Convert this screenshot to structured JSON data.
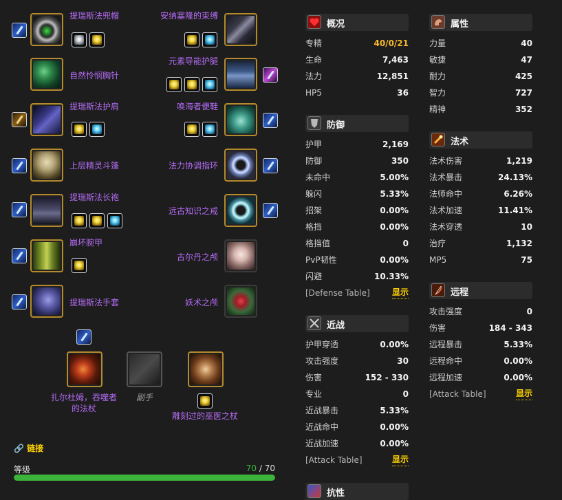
{
  "items": {
    "head": {
      "name": "提瑞斯法兜帽"
    },
    "neck": {
      "name": "自然怜悯胸针"
    },
    "shoulder": {
      "name": "提瑞斯法护肩"
    },
    "back": {
      "name": "上层精灵斗篷"
    },
    "chest": {
      "name": "提瑞斯法长袍"
    },
    "wrist": {
      "name": "崩坏腕甲"
    },
    "hands": {
      "name": "提瑞斯法手套"
    },
    "waist": {
      "name": "安纳塞隆的束缚"
    },
    "legs": {
      "name": "元素导能护腿"
    },
    "feet": {
      "name": "唤海者便鞋"
    },
    "ring1": {
      "name": "法力协调指环"
    },
    "ring2": {
      "name": "远古知识之戒"
    },
    "trinket1": {
      "name": "古尔丹之颅"
    },
    "trinket2": {
      "name": "妖术之颅"
    },
    "mainhand": {
      "name": "扎尔杜姆，吞噬者的法杖"
    },
    "offhand": {
      "name": "副手"
    },
    "ranged": {
      "name": "雕刻过的巫医之杖"
    }
  },
  "overview": {
    "title": "概况",
    "rows": [
      {
        "label": "专精",
        "value": "40/0/21"
      },
      {
        "label": "生命",
        "value": "7,463"
      },
      {
        "label": "法力",
        "value": "12,851"
      },
      {
        "label": "HP5",
        "value": "36"
      }
    ]
  },
  "defense": {
    "title": "防御",
    "rows": [
      {
        "label": "护甲",
        "value": "2,169"
      },
      {
        "label": "防御",
        "value": "350"
      },
      {
        "label": "未命中",
        "value": "5.00%"
      },
      {
        "label": "躲闪",
        "value": "5.33%"
      },
      {
        "label": "招架",
        "value": "0.00%"
      },
      {
        "label": "格挡",
        "value": "0.00%"
      },
      {
        "label": "格挡值",
        "value": "0"
      },
      {
        "label": "PvP韧性",
        "value": "0.00%"
      },
      {
        "label": "闪避",
        "value": "10.33%"
      }
    ],
    "table_label": "[Defense Table]",
    "show": "显示"
  },
  "melee": {
    "title": "近战",
    "rows": [
      {
        "label": "护甲穿透",
        "value": "0.00%"
      },
      {
        "label": "攻击强度",
        "value": "30"
      },
      {
        "label": "伤害",
        "value": "152 - 330"
      },
      {
        "label": "专业",
        "value": "0"
      },
      {
        "label": "近战暴击",
        "value": "5.33%"
      },
      {
        "label": "近战命中",
        "value": "0.00%"
      },
      {
        "label": "近战加速",
        "value": "0.00%"
      }
    ],
    "table_label": "[Attack Table]",
    "show": "显示"
  },
  "resist": {
    "title": "抗性"
  },
  "attributes": {
    "title": "属性",
    "rows": [
      {
        "label": "力量",
        "value": "40"
      },
      {
        "label": "敏捷",
        "value": "47"
      },
      {
        "label": "耐力",
        "value": "425"
      },
      {
        "label": "智力",
        "value": "727"
      },
      {
        "label": "精神",
        "value": "352"
      }
    ]
  },
  "spell": {
    "title": "法术",
    "rows": [
      {
        "label": "法术伤害",
        "value": "1,219"
      },
      {
        "label": "法术暴击",
        "value": "24.13%"
      },
      {
        "label": "法师命中",
        "value": "6.26%"
      },
      {
        "label": "法术加速",
        "value": "11.41%"
      },
      {
        "label": "法术穿透",
        "value": "10"
      },
      {
        "label": "治疗",
        "value": "1,132"
      },
      {
        "label": "MP5",
        "value": "75"
      }
    ]
  },
  "ranged": {
    "title": "远程",
    "rows": [
      {
        "label": "攻击强度",
        "value": "0"
      },
      {
        "label": "伤害",
        "value": "184 - 343"
      },
      {
        "label": "远程暴击",
        "value": "5.33%"
      },
      {
        "label": "远程命中",
        "value": "0.00%"
      },
      {
        "label": "远程加速",
        "value": "0.00%"
      }
    ],
    "table_label": "[Attack Table]",
    "show": "显示"
  },
  "link": {
    "label": "链接"
  },
  "level": {
    "label": "等级",
    "current": "70",
    "separator": " / ",
    "max": "70",
    "progress": 1.0
  },
  "colors": {
    "item_epic": "#b46cf5",
    "accent_gold": "#ffd100",
    "spec_gold": "#f5b82e",
    "bar_green": "#3bb43b"
  },
  "icons": [
    "heart-icon",
    "shield-icon",
    "swords-icon",
    "potion-icon",
    "arm-icon",
    "wand-icon",
    "bow-icon",
    "link-icon"
  ]
}
